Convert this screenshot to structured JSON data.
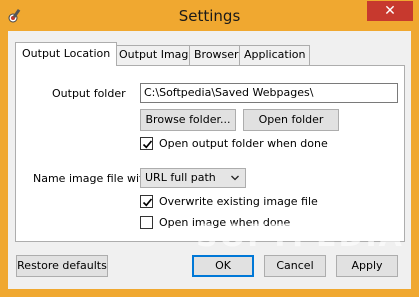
{
  "window": {
    "title": "Settings",
    "close_label": "✕"
  },
  "tabs": [
    {
      "label": "Output Location",
      "active": true
    },
    {
      "label": "Output Image",
      "active": false
    },
    {
      "label": "Browser",
      "active": false
    },
    {
      "label": "Application",
      "active": false
    }
  ],
  "output_location": {
    "folder_label": "Output folder",
    "folder_value": "C:\\Softpedia\\Saved Webpages\\",
    "browse_label": "Browse folder...",
    "open_label": "Open folder",
    "open_when_done_label": "Open output folder when done",
    "open_when_done_checked": true,
    "name_label": "Name image file with",
    "name_selected": "URL full path",
    "overwrite_label": "Overwrite existing image file",
    "overwrite_checked": true,
    "open_image_label": "Open image when done",
    "open_image_checked": false
  },
  "footer": {
    "restore_label": "Restore defaults",
    "ok_label": "OK",
    "cancel_label": "Cancel",
    "apply_label": "Apply"
  },
  "watermark": "SOFTPEDIA",
  "colors": {
    "titlebar": "#f0a830",
    "close": "#c7392e",
    "focus": "#0078d7"
  }
}
